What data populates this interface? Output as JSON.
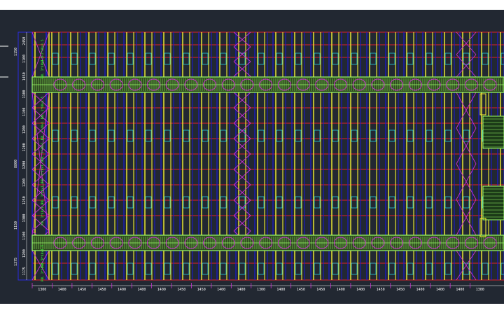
{
  "drawing": {
    "colors": {
      "background": "#222832",
      "page": "#ffffff",
      "grid_red": "#e0202a",
      "column_yellow": "#f5f233",
      "column_blue": "#1a1ad8",
      "walkway_green": "#9cff6a",
      "brace_magenta": "#c830d0",
      "cyan": "#22ccdd",
      "frame_blue": "#2a2ae0",
      "dim_white": "#ffffff",
      "label_green": "#33ff33"
    },
    "bottom_dims": [
      "1300",
      "1400",
      "1450",
      "1450",
      "1400",
      "1400",
      "1400",
      "1450",
      "1450",
      "1400",
      "1400",
      "1300",
      "1400",
      "1450",
      "1450",
      "1400",
      "1400",
      "1450",
      "1450",
      "1400",
      "1400",
      "1400",
      "1300"
    ],
    "left_dims": [
      "2450",
      "1100",
      "1450",
      "1100",
      "1100",
      "1200",
      "1200",
      "1200",
      "1200",
      "1250",
      "1300",
      "1100",
      "1200",
      "1175"
    ],
    "left_total_dims": [
      "1150",
      "8800",
      "1150",
      "1375"
    ],
    "rack_labels": [
      "LH 2-2*40x1.5",
      "PBL 1*40x1.5",
      "RBL 1*80x1.5",
      "PBL 1*40x1.5",
      "PBL 1*40x1.5",
      "PBL 1*40x1.5",
      "PBL 1*40x1.5",
      "PBL 1*40x1.5",
      "PBL 1*40x1.5",
      "PBL 1*40x1.5"
    ]
  }
}
